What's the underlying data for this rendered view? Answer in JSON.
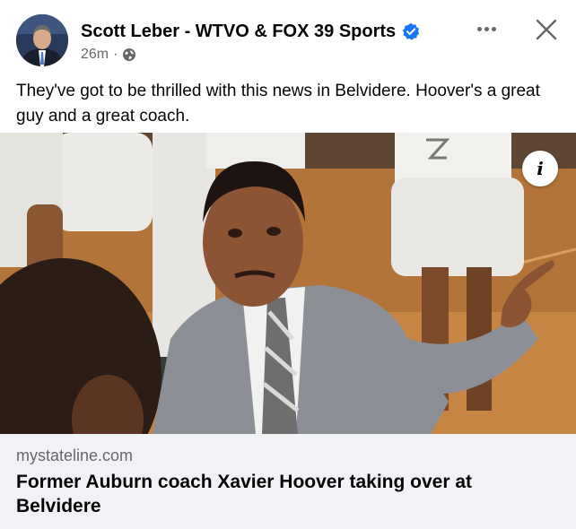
{
  "post": {
    "author": "Scott Leber - WTVO & FOX 39 Sports",
    "timestamp": "26m",
    "separator": "·",
    "privacy_icon": "globe-icon",
    "verified_icon": "verified-badge-icon",
    "text": "They've got to be thrilled with this news in Belvidere. Hoover's a great guy and a great coach."
  },
  "actions": {
    "more_icon": "more-options-icon",
    "close_icon": "close-icon"
  },
  "photo": {
    "info_label": "i"
  },
  "link_preview": {
    "domain": "mystateline.com",
    "headline": "Former Auburn coach Xavier Hoover taking over at Belvidere"
  },
  "colors": {
    "primary_text": "#050505",
    "secondary_text": "#65676b",
    "verified_blue": "#1877f2",
    "card_background": "#f0f2f5"
  }
}
